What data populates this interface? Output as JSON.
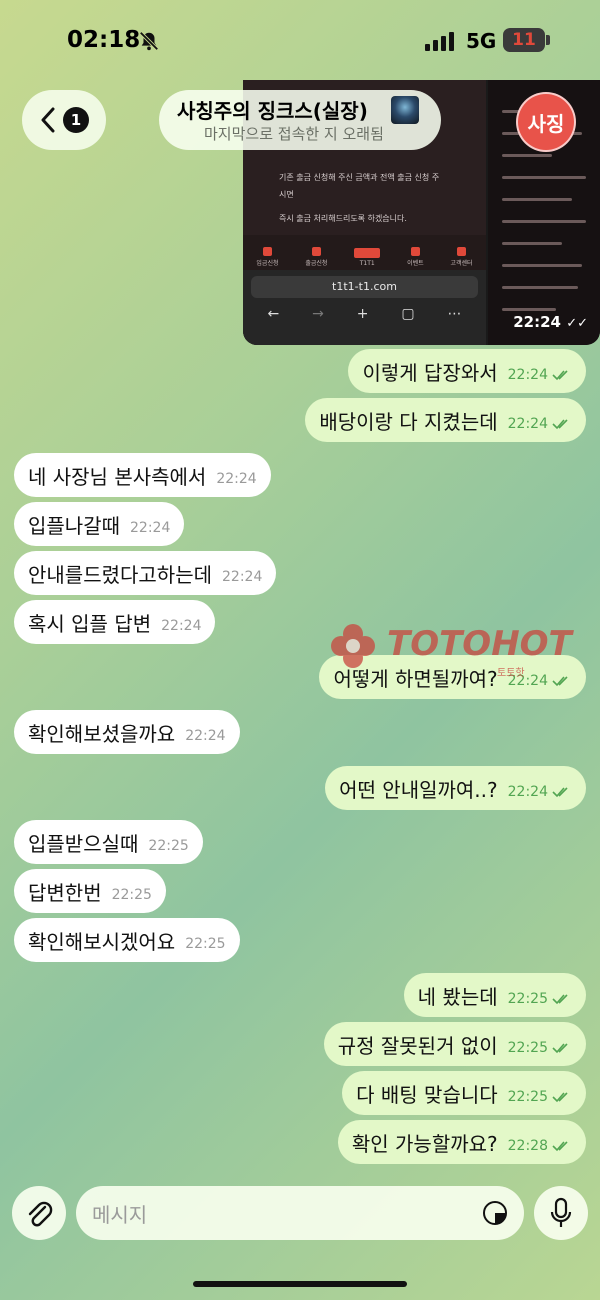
{
  "status": {
    "time": "02:18",
    "network": "5G",
    "battery": "11"
  },
  "header": {
    "back_count": "1",
    "title": "사칭주의 징크스(실장)",
    "subtitle": "마지막으로 접속한 지 오래됨",
    "site_avatar": "사징"
  },
  "photo": {
    "text1": "기존 출금 신청해 주신 금액과 전액 출금 신청 주",
    "text2": "시면",
    "text3": "즉시 출금 처리해드리도록 하겠습니다.",
    "nav": [
      "입금신청",
      "출금신청",
      "T1T1",
      "이벤트",
      "고객센터"
    ],
    "url": "t1t1-t1.com",
    "time": "22:24"
  },
  "messages": [
    {
      "dir": "out",
      "text": "이렇게 답장와서",
      "time": "22:24"
    },
    {
      "dir": "out",
      "text": "배당이랑 다 지켰는데",
      "time": "22:24"
    },
    {
      "dir": "in",
      "text": "네 사장님 본사측에서",
      "time": "22:24"
    },
    {
      "dir": "in",
      "text": "입플나갈때",
      "time": "22:24"
    },
    {
      "dir": "in",
      "text": "안내를드렸다고하는데",
      "time": "22:24"
    },
    {
      "dir": "in",
      "text": "혹시 입플 답변",
      "time": "22:24"
    },
    {
      "dir": "out",
      "text": "어떻게 하면될까여?",
      "time": "22:24"
    },
    {
      "dir": "in",
      "text": "확인해보셨을까요",
      "time": "22:24"
    },
    {
      "dir": "out",
      "text": "어떤 안내일까여..?",
      "time": "22:24"
    },
    {
      "dir": "in",
      "text": "입플받으실때",
      "time": "22:25"
    },
    {
      "dir": "in",
      "text": "답변한번",
      "time": "22:25"
    },
    {
      "dir": "in",
      "text": "확인해보시겠어요",
      "time": "22:25"
    },
    {
      "dir": "out",
      "text": "네 봤는데",
      "time": "22:25"
    },
    {
      "dir": "out",
      "text": "규정 잘못된거 없이",
      "time": "22:25"
    },
    {
      "dir": "out",
      "text": "다 배팅 맞습니다",
      "time": "22:25"
    },
    {
      "dir": "out",
      "text": "확인 가능할까요?",
      "time": "22:28"
    }
  ],
  "watermark": {
    "text": "TOTOHOT",
    "sub": "토토핫"
  },
  "input": {
    "placeholder": "메시지"
  },
  "colors": {
    "outgoing_bubble": "#e3f8c8",
    "incoming_bubble": "#ffffff",
    "accent": "#52a552"
  }
}
